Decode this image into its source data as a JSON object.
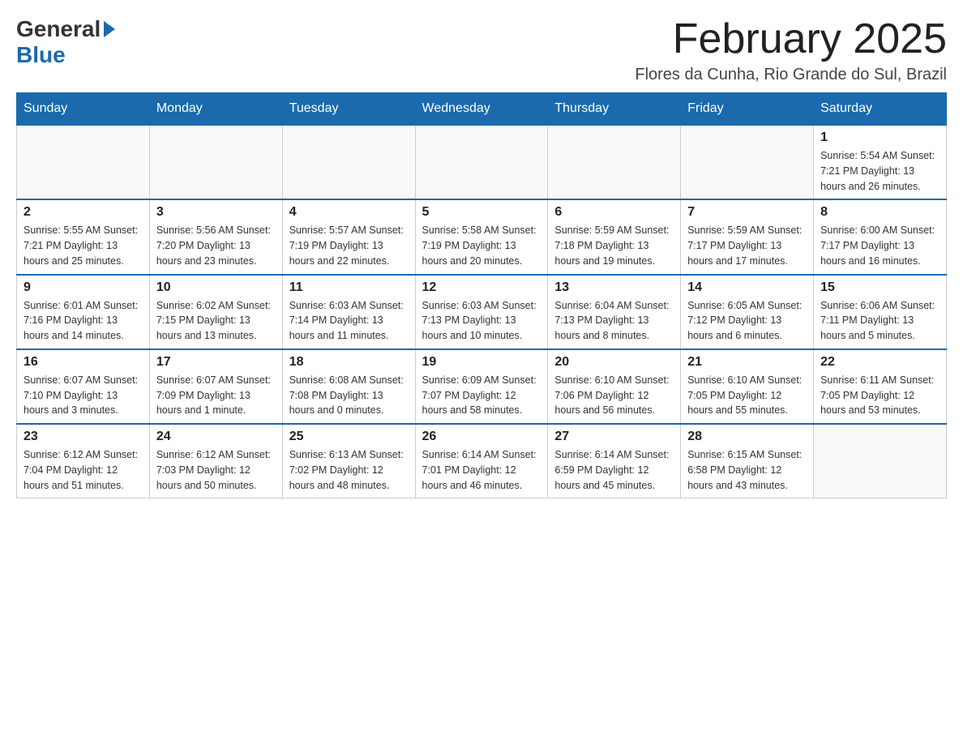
{
  "header": {
    "logo_general": "General",
    "logo_blue": "Blue",
    "month_title": "February 2025",
    "location": "Flores da Cunha, Rio Grande do Sul, Brazil"
  },
  "days_of_week": [
    "Sunday",
    "Monday",
    "Tuesday",
    "Wednesday",
    "Thursday",
    "Friday",
    "Saturday"
  ],
  "weeks": [
    [
      {
        "day": "",
        "info": ""
      },
      {
        "day": "",
        "info": ""
      },
      {
        "day": "",
        "info": ""
      },
      {
        "day": "",
        "info": ""
      },
      {
        "day": "",
        "info": ""
      },
      {
        "day": "",
        "info": ""
      },
      {
        "day": "1",
        "info": "Sunrise: 5:54 AM\nSunset: 7:21 PM\nDaylight: 13 hours and 26 minutes."
      }
    ],
    [
      {
        "day": "2",
        "info": "Sunrise: 5:55 AM\nSunset: 7:21 PM\nDaylight: 13 hours and 25 minutes."
      },
      {
        "day": "3",
        "info": "Sunrise: 5:56 AM\nSunset: 7:20 PM\nDaylight: 13 hours and 23 minutes."
      },
      {
        "day": "4",
        "info": "Sunrise: 5:57 AM\nSunset: 7:19 PM\nDaylight: 13 hours and 22 minutes."
      },
      {
        "day": "5",
        "info": "Sunrise: 5:58 AM\nSunset: 7:19 PM\nDaylight: 13 hours and 20 minutes."
      },
      {
        "day": "6",
        "info": "Sunrise: 5:59 AM\nSunset: 7:18 PM\nDaylight: 13 hours and 19 minutes."
      },
      {
        "day": "7",
        "info": "Sunrise: 5:59 AM\nSunset: 7:17 PM\nDaylight: 13 hours and 17 minutes."
      },
      {
        "day": "8",
        "info": "Sunrise: 6:00 AM\nSunset: 7:17 PM\nDaylight: 13 hours and 16 minutes."
      }
    ],
    [
      {
        "day": "9",
        "info": "Sunrise: 6:01 AM\nSunset: 7:16 PM\nDaylight: 13 hours and 14 minutes."
      },
      {
        "day": "10",
        "info": "Sunrise: 6:02 AM\nSunset: 7:15 PM\nDaylight: 13 hours and 13 minutes."
      },
      {
        "day": "11",
        "info": "Sunrise: 6:03 AM\nSunset: 7:14 PM\nDaylight: 13 hours and 11 minutes."
      },
      {
        "day": "12",
        "info": "Sunrise: 6:03 AM\nSunset: 7:13 PM\nDaylight: 13 hours and 10 minutes."
      },
      {
        "day": "13",
        "info": "Sunrise: 6:04 AM\nSunset: 7:13 PM\nDaylight: 13 hours and 8 minutes."
      },
      {
        "day": "14",
        "info": "Sunrise: 6:05 AM\nSunset: 7:12 PM\nDaylight: 13 hours and 6 minutes."
      },
      {
        "day": "15",
        "info": "Sunrise: 6:06 AM\nSunset: 7:11 PM\nDaylight: 13 hours and 5 minutes."
      }
    ],
    [
      {
        "day": "16",
        "info": "Sunrise: 6:07 AM\nSunset: 7:10 PM\nDaylight: 13 hours and 3 minutes."
      },
      {
        "day": "17",
        "info": "Sunrise: 6:07 AM\nSunset: 7:09 PM\nDaylight: 13 hours and 1 minute."
      },
      {
        "day": "18",
        "info": "Sunrise: 6:08 AM\nSunset: 7:08 PM\nDaylight: 13 hours and 0 minutes."
      },
      {
        "day": "19",
        "info": "Sunrise: 6:09 AM\nSunset: 7:07 PM\nDaylight: 12 hours and 58 minutes."
      },
      {
        "day": "20",
        "info": "Sunrise: 6:10 AM\nSunset: 7:06 PM\nDaylight: 12 hours and 56 minutes."
      },
      {
        "day": "21",
        "info": "Sunrise: 6:10 AM\nSunset: 7:05 PM\nDaylight: 12 hours and 55 minutes."
      },
      {
        "day": "22",
        "info": "Sunrise: 6:11 AM\nSunset: 7:05 PM\nDaylight: 12 hours and 53 minutes."
      }
    ],
    [
      {
        "day": "23",
        "info": "Sunrise: 6:12 AM\nSunset: 7:04 PM\nDaylight: 12 hours and 51 minutes."
      },
      {
        "day": "24",
        "info": "Sunrise: 6:12 AM\nSunset: 7:03 PM\nDaylight: 12 hours and 50 minutes."
      },
      {
        "day": "25",
        "info": "Sunrise: 6:13 AM\nSunset: 7:02 PM\nDaylight: 12 hours and 48 minutes."
      },
      {
        "day": "26",
        "info": "Sunrise: 6:14 AM\nSunset: 7:01 PM\nDaylight: 12 hours and 46 minutes."
      },
      {
        "day": "27",
        "info": "Sunrise: 6:14 AM\nSunset: 6:59 PM\nDaylight: 12 hours and 45 minutes."
      },
      {
        "day": "28",
        "info": "Sunrise: 6:15 AM\nSunset: 6:58 PM\nDaylight: 12 hours and 43 minutes."
      },
      {
        "day": "",
        "info": ""
      }
    ]
  ]
}
